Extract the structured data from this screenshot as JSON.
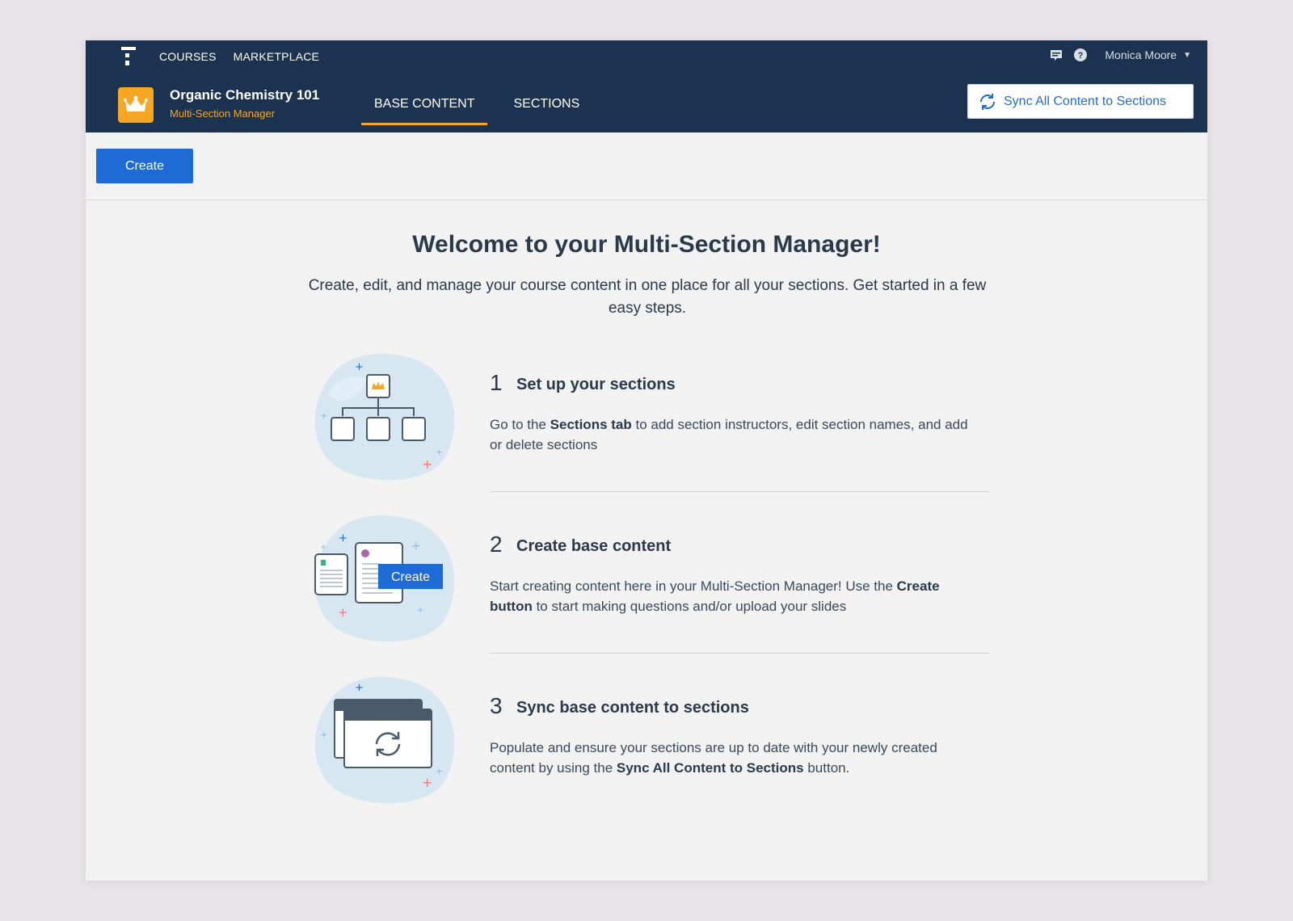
{
  "colors": {
    "header_bg": "#1b3350",
    "accent": "#f5a623",
    "primary": "#1f6bd6",
    "app_bg": "#f2f2f2",
    "page_bg": "#e8e3e8"
  },
  "header": {
    "nav": [
      {
        "label": "COURSES"
      },
      {
        "label": "MARKETPLACE"
      }
    ],
    "user": {
      "name": "Monica Moore"
    },
    "icons": [
      "chat-icon",
      "help-icon",
      "chevron-down-icon"
    ]
  },
  "course": {
    "title": "Organic Chemistry 101",
    "subtitle": "Multi-Section Manager",
    "icon": "crown-icon"
  },
  "tabs": [
    {
      "label": "BASE CONTENT",
      "active": true
    },
    {
      "label": "SECTIONS",
      "active": false
    }
  ],
  "sync_button": {
    "label": "Sync All Content to Sections",
    "icon": "sync-icon"
  },
  "toolbar": {
    "create_label": "Create"
  },
  "welcome": {
    "title": "Welcome to your Multi-Section Manager!",
    "description": "Create, edit, and manage your course content in one place for all your sections. Get started in a few easy steps."
  },
  "steps": [
    {
      "number": "1",
      "title": "Set up your sections",
      "desc_parts": [
        "Go to the ",
        "Sections tab",
        " to add section instructors, edit section names, and add or delete sections"
      ],
      "illustration": "org-chart-illustration"
    },
    {
      "number": "2",
      "title": "Create base content",
      "desc_parts": [
        "Start creating content here in your Multi-Section Manager! Use the ",
        "Create button",
        " to start making questions and/or upload your slides"
      ],
      "illustration_button": "Create",
      "illustration": "documents-illustration"
    },
    {
      "number": "3",
      "title": "Sync base content to sections",
      "desc_parts": [
        "Populate and ensure your sections are up to date with your newly created content by using the ",
        "Sync All Content to Sections",
        " button."
      ],
      "illustration": "sync-windows-illustration"
    }
  ]
}
